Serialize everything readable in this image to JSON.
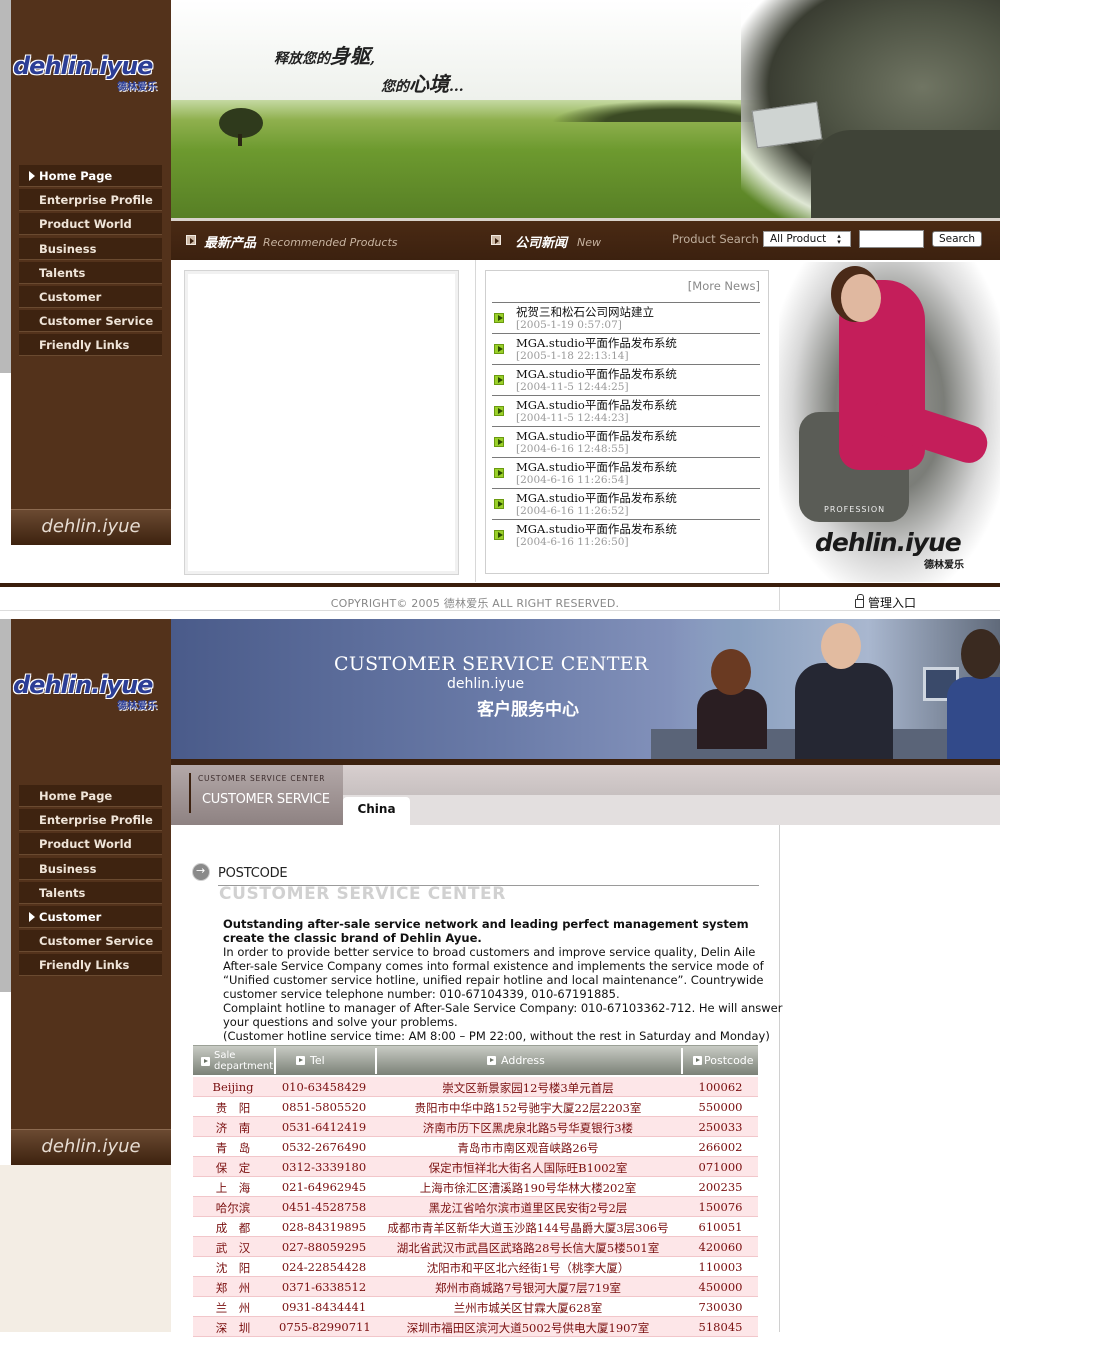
{
  "section1": {
    "sidebar": {
      "logo_main": "dehlin.iyue",
      "logo_sub": "德林爱乐",
      "items": [
        {
          "label": "Home Page",
          "active": true
        },
        {
          "label": "Enterprise Profile"
        },
        {
          "label": "Product World"
        },
        {
          "label": "Business Cooperation"
        },
        {
          "label": "Talents Recruitment"
        },
        {
          "label": "Customer Comment"
        },
        {
          "label": "Customer Service"
        },
        {
          "label": "Friendly Links"
        }
      ],
      "footer_brand": "dehlin.iyue"
    },
    "banner": {
      "slogan_line1_prefix": "释放您的",
      "slogan_line1_big": "身躯",
      "slogan_line1_suffix": ",",
      "slogan_line2_prefix": "您的",
      "slogan_line2_big": "心境",
      "slogan_line2_suffix": "..."
    },
    "bar": {
      "products_cn": "最新产品",
      "products_en": "Recommended Products",
      "news_cn": "公司新闻",
      "news_en": "New",
      "search_label": "Product Search",
      "search_select_value": "All Product",
      "search_input_value": "",
      "search_button": "Search"
    },
    "news": {
      "more_label": "[More News]",
      "items": [
        {
          "title": "祝贺三和松石公司网站建立",
          "date": "[2005-1-19 0:57:07]"
        },
        {
          "title": "MGA.studio平面作品发布系统",
          "date": "[2005-1-18 22:13:14]"
        },
        {
          "title": "MGA.studio平面作品发布系统",
          "date": "[2004-11-5 12:44:25]"
        },
        {
          "title": "MGA.studio平面作品发布系统",
          "date": "[2004-11-5 12:44:23]"
        },
        {
          "title": "MGA.studio平面作品发布系统",
          "date": "[2004-6-16 12:48:55]"
        },
        {
          "title": "MGA.studio平面作品发布系统",
          "date": "[2004-6-16 11:26:54]"
        },
        {
          "title": "MGA.studio平面作品发布系统",
          "date": "[2004-6-16 11:26:52]"
        },
        {
          "title": "MGA.studio平面作品发布系统",
          "date": "[2004-6-16 11:26:50]"
        }
      ]
    },
    "model_panel": {
      "small_text": "PROFESSION",
      "logo": "dehlin.iyue",
      "logo_sub": "德林爱乐"
    },
    "footer": {
      "copyright": "COPYRIGHT© 2005 德林爱乐 ALL RIGHT RESERVED.",
      "admin": "管理入口"
    }
  },
  "section2": {
    "sidebar": {
      "logo_main": "dehlin.iyue",
      "logo_sub": "德林爱乐",
      "items": [
        {
          "label": "Home Page"
        },
        {
          "label": "Enterprise Profile"
        },
        {
          "label": "Product World"
        },
        {
          "label": "Business Cooperation"
        },
        {
          "label": "Talents Recruitment"
        },
        {
          "label": "Customer Comment",
          "active": true
        },
        {
          "label": "Customer Service"
        },
        {
          "label": "Friendly Links"
        }
      ],
      "footer_brand": "dehlin.iyue"
    },
    "banner": {
      "title_en": "CUSTOMER SERVICE CENTER",
      "brand": "dehlin.iyue",
      "title_cn": "客户服务中心"
    },
    "tab_header": {
      "small": "CUSTOMER SERVICE CENTER",
      "big": "CUSTOMER SERVICE",
      "tab": "China"
    },
    "postcode": {
      "title": "POSTCODE",
      "watermark": "CUSTOMER SERVICE CENTER"
    },
    "intro": {
      "lead": "Outstanding after-sale service network and leading perfect management system create the classic brand of Dehlin Ayue.",
      "p1": "In order to provide better service to broad customers and improve service quality, Delin Aile After-sale Service Company comes into formal existence and implements the service mode of “Unified customer service hotline, unified repair hotline and local maintenance”. Countrywide customer service telephone number: 010-67104339, 010-67191885.",
      "p2": "Complaint hotline to manager of After-Sale Service Company: 010-67103362-712. He will answer your questions and solve your problems.",
      "p3": "(Customer hotline service time: AM 8:00 – PM 22:00, without the rest in Saturday and Monday)"
    },
    "table": {
      "headers": {
        "city_line1": "Sale",
        "city_line2": "department",
        "tel": "Tel",
        "address": "Address",
        "postcode": "Postcode"
      },
      "rows": [
        {
          "city": "Beijing",
          "tel": "010-63458429",
          "address": "崇文区新景家园12号楼3单元首层",
          "postcode": "100062"
        },
        {
          "city": "贵　阳",
          "tel": "0851-5805520",
          "address": "贵阳市中华中路152号驰宇大厦22层2203室",
          "postcode": "550000"
        },
        {
          "city": "济　南",
          "tel": "0531-6412419",
          "address": "济南市历下区黑虎泉北路5号华夏银行3楼",
          "postcode": "250033"
        },
        {
          "city": "青　岛",
          "tel": "0532-2676490",
          "address": "青岛市市南区观音峡路26号",
          "postcode": "266002"
        },
        {
          "city": "保　定",
          "tel": "0312-3339180",
          "address": "保定市恒祥北大街名人国际旺B1002室",
          "postcode": "071000"
        },
        {
          "city": "上　海",
          "tel": "021-64962945",
          "address": "上海市徐汇区漕溪路190号华林大楼202室",
          "postcode": "200235"
        },
        {
          "city": "哈尔滨",
          "tel": "0451-4528758",
          "address": "黑龙江省哈尔滨市道里区民安街2号2层",
          "postcode": "150076"
        },
        {
          "city": "成　都",
          "tel": "028-84319895",
          "address": "成都市青羊区新华大道玉沙路144号晶爵大厦3层306号",
          "postcode": "610051"
        },
        {
          "city": "武　汉",
          "tel": "027-88059295",
          "address": "湖北省武汉市武昌区武珞路28号长信大厦5楼501室",
          "postcode": "420060"
        },
        {
          "city": "沈　阳",
          "tel": "024-22854428",
          "address": "沈阳市和平区北六经街1号（桃李大厦）",
          "postcode": "110003"
        },
        {
          "city": "郑　州",
          "tel": "0371-6338512",
          "address": "郑州市商城路7号银河大厦7层719室",
          "postcode": "450000"
        },
        {
          "city": "兰　州",
          "tel": "0931-8434441",
          "address": "兰州市城关区甘霖大厦628室",
          "postcode": "730030"
        },
        {
          "city": "深　圳",
          "tel": "0755-82990711",
          "address": "深圳市福田区滨河大道5002号供电大厦1907室",
          "postcode": "518045"
        }
      ]
    }
  }
}
